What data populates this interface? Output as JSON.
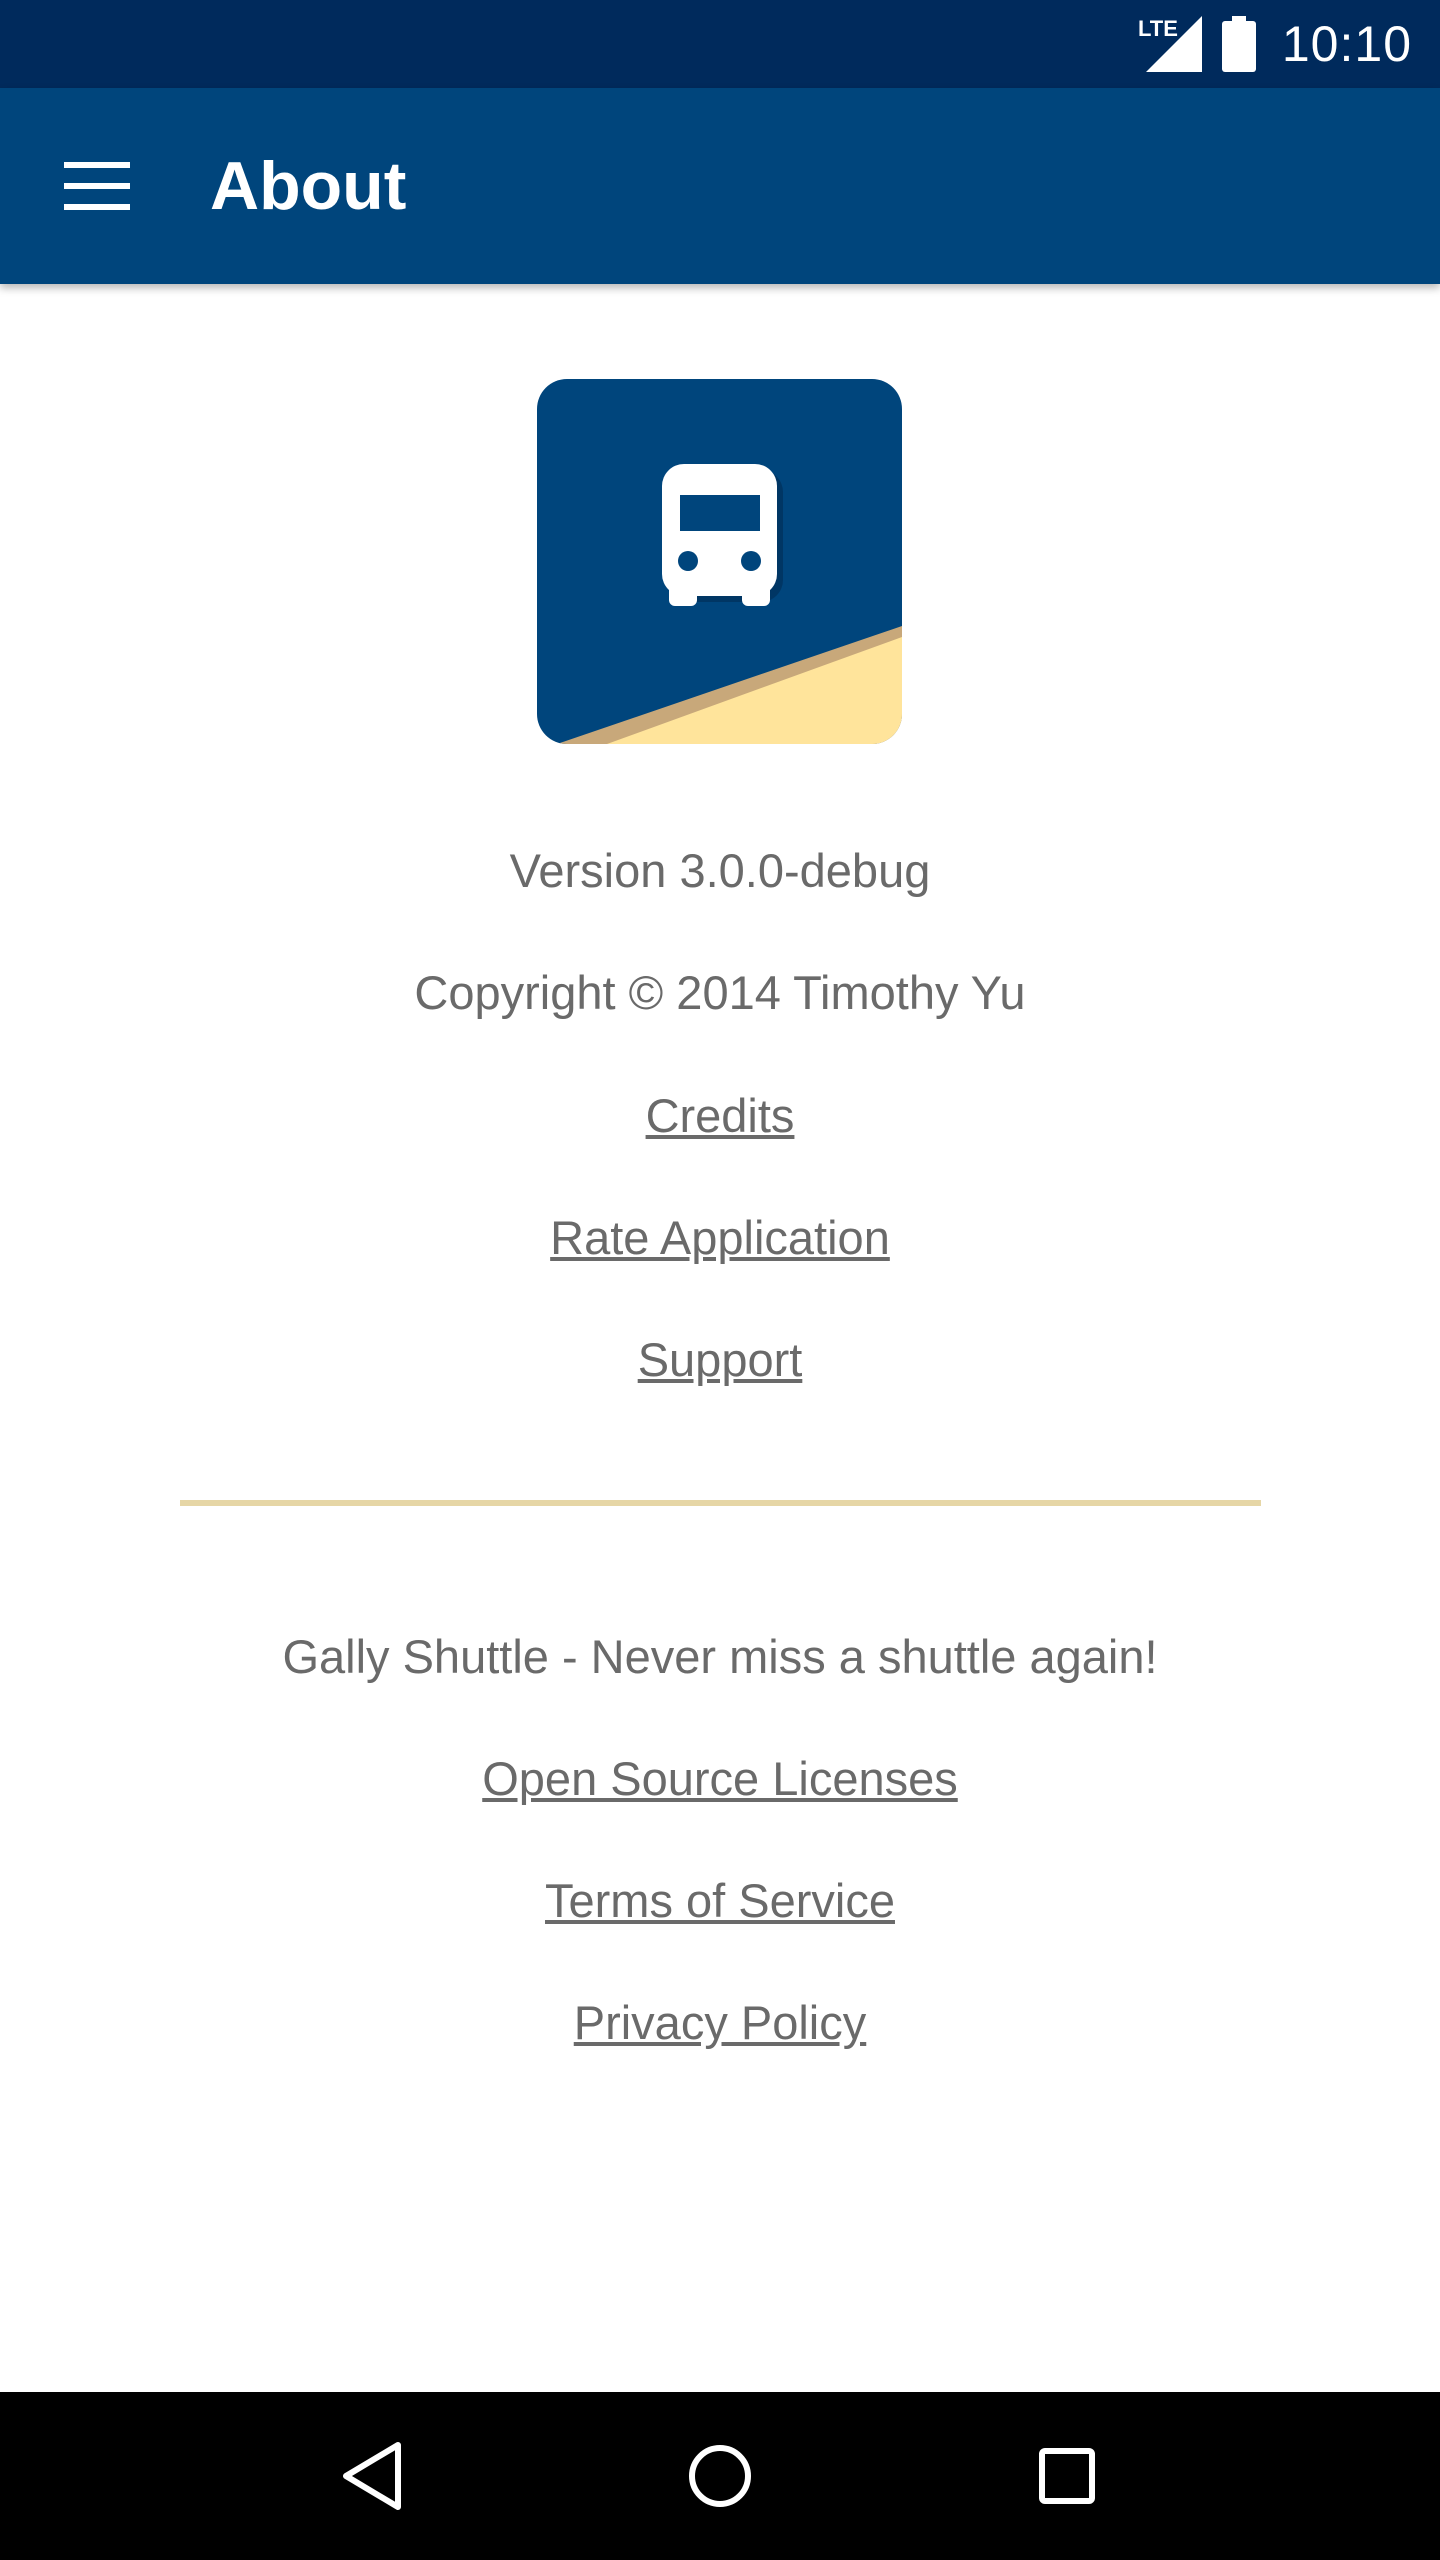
{
  "status_bar": {
    "network_label": "LTE",
    "time": "10:10"
  },
  "app_bar": {
    "title": "About",
    "menu_icon": "hamburger-menu-icon"
  },
  "logo": {
    "icon": "bus-icon",
    "colors": {
      "background": "#00457c",
      "accent": "#ffe49b",
      "accent_shadow": "#c8a87a"
    }
  },
  "about": {
    "version": "Version 3.0.0-debug",
    "copyright": "Copyright © 2014 Timothy Yu",
    "links_top": [
      "Credits",
      "Rate Application",
      "Support"
    ],
    "tagline": "Gally Shuttle - Never miss a shuttle again!",
    "links_bottom": [
      "Open Source Licenses",
      "Terms of Service",
      "Privacy Policy"
    ]
  },
  "nav_bar": {
    "back_icon": "back-triangle-icon",
    "home_icon": "home-circle-icon",
    "recents_icon": "recents-square-icon"
  },
  "colors": {
    "status_bar": "#002a5c",
    "app_bar": "#00457c",
    "text": "#6a6a6a",
    "divider": "#e6d6a6"
  }
}
